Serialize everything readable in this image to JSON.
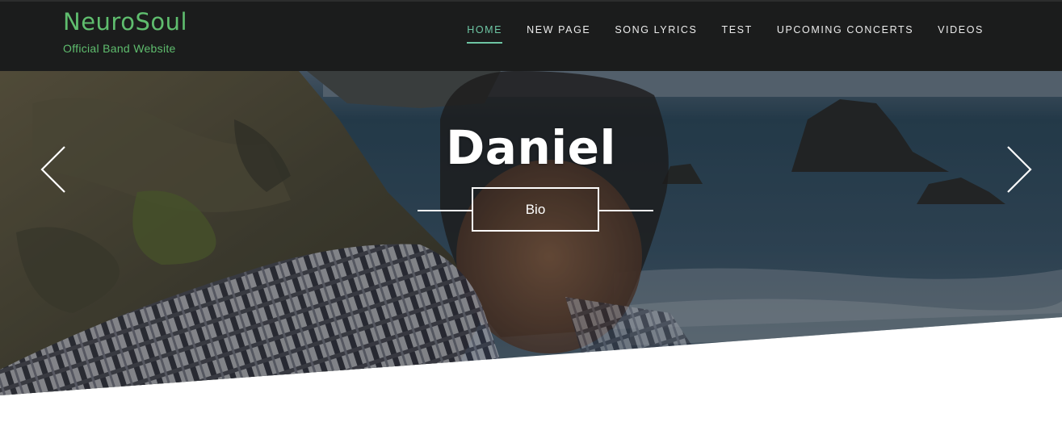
{
  "brand": {
    "title": "NeuroSoul",
    "subtitle": "Official Band Website"
  },
  "nav": {
    "items": [
      {
        "label": "HOME",
        "active": true
      },
      {
        "label": "NEW PAGE",
        "active": false
      },
      {
        "label": "SONG LYRICS",
        "active": false
      },
      {
        "label": "TEST",
        "active": false
      },
      {
        "label": "UPCOMING CONCERTS",
        "active": false
      },
      {
        "label": "VIDEOS",
        "active": false
      }
    ]
  },
  "hero": {
    "title": "Daniel",
    "button_label": "Bio",
    "prev_icon": "chevron-left-icon",
    "next_icon": "chevron-right-icon"
  },
  "colors": {
    "header_bg": "#1b1c1c",
    "brand_green": "#5fbd6e",
    "nav_active": "#6dc5a3",
    "nav_text": "#ececec"
  }
}
